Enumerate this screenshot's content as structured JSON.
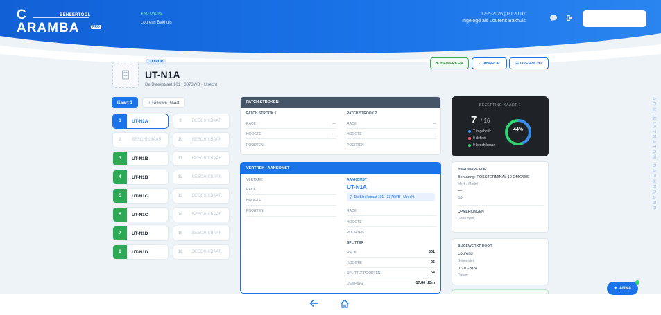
{
  "header": {
    "logo_line1": "C",
    "logo_line2": "ARAMBA",
    "logo_subtitle": "BEHEERTOOL",
    "logo_badge": "PRO",
    "online_status": "● NU ONLINE",
    "username": "Lourens Bakhuis",
    "date_line": "17-5-2026 | 00:20:07",
    "logged_in_line": "Ingelogd als Lourens Bakhuis",
    "icons": [
      "chat-icon",
      "logout-icon"
    ]
  },
  "side_label": "ADMINISTRATOR DASHBOARD",
  "location": {
    "badge": "CITYPOP",
    "title": "UT-N1A",
    "address": "De Bleekstraat 101 · 3373WB · Utrecht"
  },
  "actions": {
    "edit": "BEWERKEN",
    "annotate": "ANNPOP",
    "overview": "OVERZICHT"
  },
  "tabs": {
    "card1": "Kaart 1",
    "new_card": "+ Nieuwe Kaart"
  },
  "slots_left": [
    {
      "num": "1",
      "label": "UT-N1A",
      "state": "active"
    },
    {
      "num": "2",
      "label": "BESCHIKBAAR",
      "state": "free"
    },
    {
      "num": "3",
      "label": "UT-N1B",
      "state": "used"
    },
    {
      "num": "4",
      "label": "UT-N1B",
      "state": "used"
    },
    {
      "num": "5",
      "label": "UT-N1C",
      "state": "used"
    },
    {
      "num": "6",
      "label": "UT-N1C",
      "state": "used"
    },
    {
      "num": "7",
      "label": "UT-N1D",
      "state": "used"
    },
    {
      "num": "8",
      "label": "UT-N1D",
      "state": "used"
    }
  ],
  "slots_right": [
    {
      "num": "9",
      "label": "BESCHIKBAAR"
    },
    {
      "num": "10",
      "label": "BESCHIKBAAR"
    },
    {
      "num": "11",
      "label": "BESCHIKBAAR"
    },
    {
      "num": "12",
      "label": "BESCHIKBAAR"
    },
    {
      "num": "13",
      "label": "BESCHIKBAAR"
    },
    {
      "num": "14",
      "label": "BESCHIKBAAR"
    },
    {
      "num": "15",
      "label": "BESCHIKBAAR"
    },
    {
      "num": "16",
      "label": "BESCHIKBAAR"
    }
  ],
  "patch": {
    "title": "PATCH STROKEN",
    "strook1": "PATCH STROOK 1",
    "strook2": "PATCH STROOK 2",
    "rack": "RACK",
    "hoogte": "HOOGTE",
    "poorten": "POORTEN",
    "dash": "—"
  },
  "route": {
    "title": "VERTREK / AANKOMST",
    "vertrek": "VERTREK",
    "rack": "RACK",
    "hoogte": "HOOGTE",
    "poorten": "POORTEN",
    "aankomst_label": "AANKOMST",
    "aankomst_code": "UT-N1A",
    "aankomst_addr": "De Bleekstraat 101 · 3373WB · Utrecht",
    "right_rack": "RACK",
    "right_hoogte": "HOOGTE",
    "right_poorten": "POORTEN",
    "splitter": "SPLITTER",
    "s_rack": "RACK",
    "s_rack_val": "301",
    "s_hoogte": "HOOGTE",
    "s_hoogte_val": "26",
    "s_poorten": "SPLITTERPOORTEN",
    "s_poorten_val": "64",
    "s_demping": "DEMPING",
    "s_demping_val": "-17.80 dBm"
  },
  "occupancy": {
    "title": "BEZETTING KAART 1",
    "used": "7",
    "total": "/ 16",
    "percent": "44%",
    "percent_value": 0.44,
    "legend": [
      {
        "label": "7 in gebruik",
        "color": "#3b8cf0"
      },
      {
        "label": "0 defect",
        "color": "#ff4d5e"
      },
      {
        "label": "9 beschikbaar",
        "color": "#2ed573"
      }
    ]
  },
  "hardware": {
    "title": "HARDWARE POP",
    "model": "Behuizing: POSSTERMINAL 10 OMG/800",
    "sub": "Merk / Model",
    "dash": "—",
    "sn": "S/N",
    "notes_label": "OPMERKINGEN",
    "notes_val": "Geen opm."
  },
  "updated": {
    "title": "BIJGEWERKT DOOR",
    "name": "Lourens",
    "role": "Beheerder",
    "date": "07-10-2024",
    "time": "Datum"
  },
  "footer": {
    "back_icon": "arrow-left-icon",
    "home_icon": "home-icon",
    "assistant": "ANNA"
  }
}
